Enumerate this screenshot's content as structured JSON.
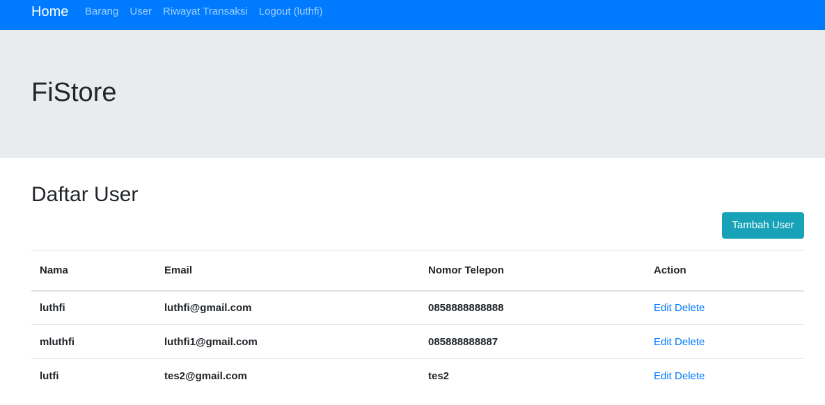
{
  "navbar": {
    "brand": "Home",
    "links": [
      "Barang",
      "User",
      "Riwayat Transaksi",
      "Logout (luthfi)"
    ]
  },
  "jumbotron": {
    "title": "FiStore"
  },
  "main": {
    "title": "Daftar User",
    "add_button_label": "Tambah User",
    "table": {
      "headers": [
        "Nama",
        "Email",
        "Nomor Telepon",
        "Action"
      ],
      "rows": [
        {
          "nama": "luthfi",
          "email": "luthfi@gmail.com",
          "phone": "0858888888888",
          "edit": "Edit",
          "delete": "Delete"
        },
        {
          "nama": "mluthfi",
          "email": "luthfi1@gmail.com",
          "phone": "085888888887",
          "edit": "Edit",
          "delete": "Delete"
        },
        {
          "nama": "lutfi",
          "email": "tes2@gmail.com",
          "phone": "tes2",
          "edit": "Edit",
          "delete": "Delete"
        }
      ]
    }
  },
  "colors": {
    "navbar": "#007bff",
    "jumbotron": "#e9ecef",
    "add_button": "#17a2b8",
    "link": "#007bff"
  }
}
